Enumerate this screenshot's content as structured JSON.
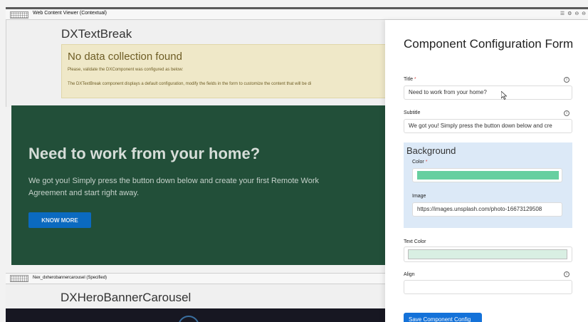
{
  "portlet": {
    "title": "Web Content Viewer (Contextual)",
    "controls": "☰ ⚙ ⊖ ⊖"
  },
  "component": {
    "title": "DXTextBreak",
    "alert_title": "No data collection found",
    "alert_line1": "Please, validate the DXComponent was configured as below:",
    "alert_line2": "The DXTextBreak component displays a default configuration, modify the fields in the form to customize the content that will be di"
  },
  "banner": {
    "title": "Need to work from your home?",
    "text": "We got you! Simply press the button down below and create your first Remote Work Agreement and start right away.",
    "button": "KNOW MORE",
    "bg_color": "#224f39"
  },
  "portlet2": {
    "title": "Nex_dxherobannercarousel (Specified)",
    "component_title": "DXHeroBannerCarousel"
  },
  "form": {
    "title": "Component Configuration Form",
    "title_label": "Title",
    "title_value": "Need to work from your home?",
    "subtitle_label": "Subtitle",
    "subtitle_value": "We got you! Simply press the button down below and cre",
    "background_heading": "Background",
    "color_label": "Color",
    "color_value": "#66cfa0",
    "image_label": "Image",
    "image_value": "https://images.unsplash.com/photo-16673129508",
    "text_color_label": "Text Color",
    "text_color_value": "#d9efe3",
    "align_label": "Align",
    "align_value": "",
    "save_button": "Save Component Config",
    "required_mark": "*",
    "info_glyph": "i"
  },
  "colors": {
    "accent": "#1472d9",
    "panel_bg": "#dce9f7",
    "alert_bg": "#efe8c8"
  }
}
